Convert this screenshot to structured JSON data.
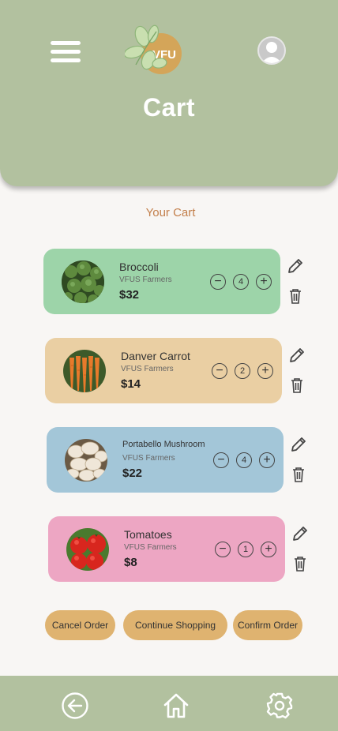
{
  "header": {
    "title": "Cart",
    "logo_text": "VFU",
    "menu_icon": "hamburger-menu-icon",
    "avatar_icon": "user-avatar-icon"
  },
  "cart": {
    "heading": "Your Cart",
    "items": [
      {
        "name": "Broccoli",
        "farm": "VFUS Farmers",
        "price": "$32",
        "qty": "4",
        "color": "#9dd4a9"
      },
      {
        "name": "Danver Carrot",
        "farm": "VFUS Farmers",
        "price": "$14",
        "qty": "2",
        "color": "#eacfa3"
      },
      {
        "name": "Portabello Mushroom",
        "farm": "VFUS Farmers",
        "price": "$22",
        "qty": "4",
        "color": "#a3c6d8"
      },
      {
        "name": "Tomatoes",
        "farm": "VFUS Farmers",
        "price": "$8",
        "qty": "1",
        "color": "#eda6c3"
      }
    ],
    "minus_symbol": "−",
    "plus_symbol": "+"
  },
  "actions": {
    "cancel": "Cancel Order",
    "continue": "Continue Shopping",
    "confirm": "Confirm Order",
    "button_color": "#dfb370"
  },
  "footer": {
    "icons": [
      "back-arrow-icon",
      "home-icon",
      "settings-gear-icon"
    ],
    "color": "#b2c19f"
  },
  "colors": {
    "header": "#b2c19f",
    "accent_text": "#c37f4b",
    "background": "#f8f6f4"
  }
}
